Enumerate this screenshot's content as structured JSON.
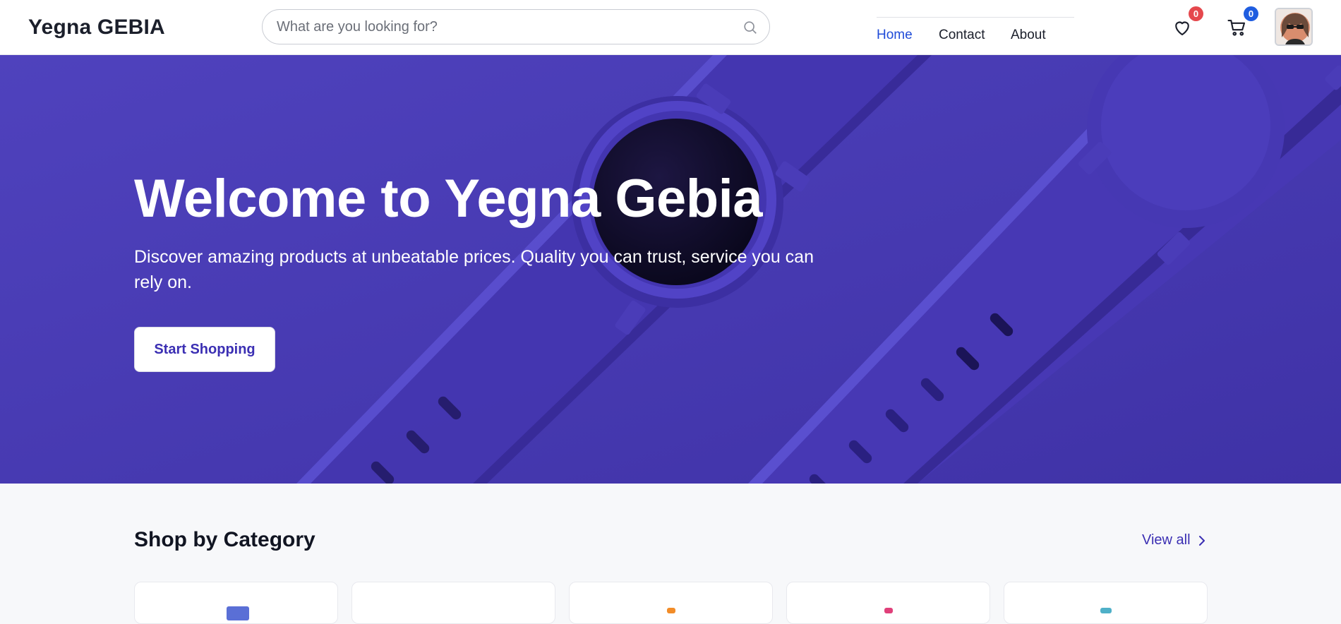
{
  "header": {
    "brand": "Yegna GEBIA",
    "search_placeholder": "What are you looking for?",
    "nav": [
      {
        "label": "Home",
        "active": true
      },
      {
        "label": "Contact",
        "active": false
      },
      {
        "label": "About",
        "active": false
      }
    ],
    "wishlist_count": "0",
    "cart_count": "0",
    "icons": [
      "search-icon",
      "heart-icon",
      "cart-icon",
      "avatar"
    ]
  },
  "hero": {
    "title": "Welcome to Yegna Gebia",
    "subtitle": "Discover amazing products at unbeatable prices. Quality you can trust, service you can rely on.",
    "cta_label": "Start Shopping",
    "background_color": "#4a3cb4"
  },
  "categories": {
    "title": "Shop by Category",
    "view_all_label": "View all",
    "icon_colors": [
      "#5a6fd6",
      "#ffffff",
      "#f28c28",
      "#e0407a",
      "#4fb0c8"
    ]
  },
  "colors": {
    "accent": "#3b2fb3",
    "nav_active": "#1f4bd8",
    "badge_wishlist": "#e5484d",
    "badge_cart": "#1f5de0"
  }
}
